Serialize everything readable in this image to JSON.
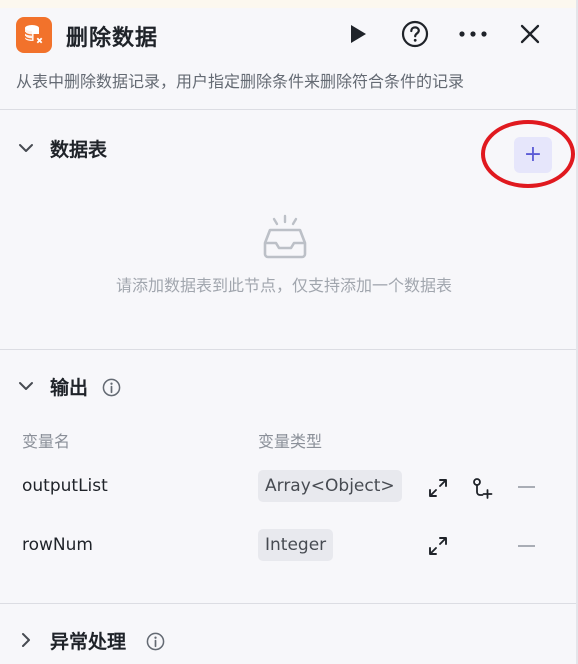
{
  "header": {
    "title": "删除数据",
    "description": "从表中删除数据记录，用户指定删除条件来删除符合条件的记录"
  },
  "table_section": {
    "title": "数据表",
    "add_label": "+",
    "empty_text": "请添加数据表到此节点，仅支持添加一个数据表"
  },
  "output_section": {
    "title": "输出",
    "col_name": "变量名",
    "col_type": "变量类型",
    "rows": [
      {
        "name": "outputList",
        "type": "Array<Object>"
      },
      {
        "name": "rowNum",
        "type": "Integer"
      }
    ]
  },
  "exception_section": {
    "title": "异常处理"
  },
  "colors": {
    "node_icon_bg": "#f2722b",
    "accent": "#5b5bd6",
    "annotation": "#e0191f"
  }
}
